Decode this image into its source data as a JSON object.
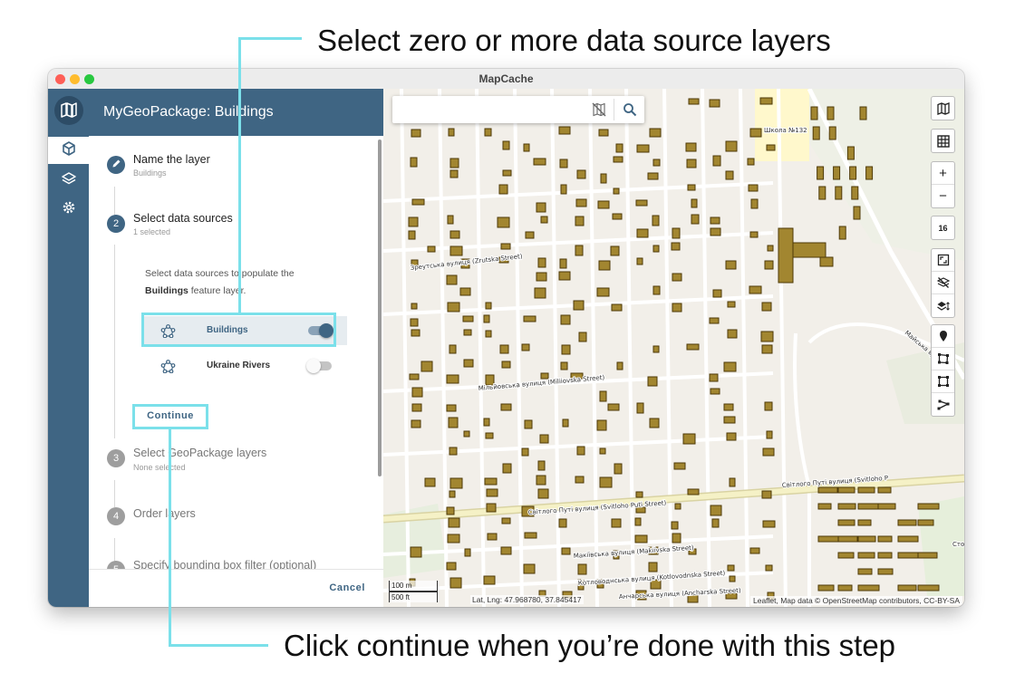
{
  "callouts": {
    "top": "Select zero or more data source layers",
    "bottom": "Click continue when you’re done with this step"
  },
  "window": {
    "title": "MapCache"
  },
  "panel": {
    "title": "MyGeoPackage: Buildings",
    "steps": [
      {
        "number": "1",
        "title": "Name the layer",
        "subtitle": "Buildings"
      },
      {
        "number": "2",
        "title": "Select data sources",
        "subtitle": "1 selected"
      },
      {
        "number": "3",
        "title": "Select GeoPackage layers",
        "subtitle": "None selected"
      },
      {
        "number": "4",
        "title": "Order layers",
        "subtitle": ""
      },
      {
        "number": "5",
        "title": "Specify bounding box filter (optional)",
        "subtitle": ""
      }
    ],
    "description_pre": "Select data sources to populate the",
    "description_bold": "Buildings",
    "description_post": "feature layer.",
    "data_sources": [
      {
        "label": "Buildings",
        "enabled": true
      },
      {
        "label": "Ukraine Rivers",
        "enabled": false
      }
    ],
    "continue_label": "Continue",
    "cancel_label": "Cancel"
  },
  "map": {
    "zoom": "16",
    "scale_m": "100 m",
    "scale_ft": "500 ft",
    "latlng": "Lat, Lng: 47.968780, 37.845417",
    "attribution": "Leaflet, Map data © OpenStreetMap contributors, CC-BY-SA",
    "street_labels": [
      "Зреутська вулиця (Zrutska Street)",
      "Мільйовська вулиця (Miliiovska Street)",
      "Світлого Путі вулиця (Svitloho Puti Street)",
      "Світлого Путі вулиця (Svitloho P",
      "Макіївська вулиця (Makiivska Street)",
      "Котловоднська вулиця (Kotlovodnska Street)",
      "Анчарська вулиця (Ancharska Street)",
      "Майська вулиця",
      "Школа №132",
      "Сто"
    ]
  },
  "colors": {
    "accent": "#3f6583",
    "callout_line": "#7be0ea",
    "building_fill": "#a28630",
    "building_stroke": "#4e3a08",
    "road": "#ffffff",
    "main_road": "#f5f1c6",
    "school_area": "#fff8cc"
  }
}
